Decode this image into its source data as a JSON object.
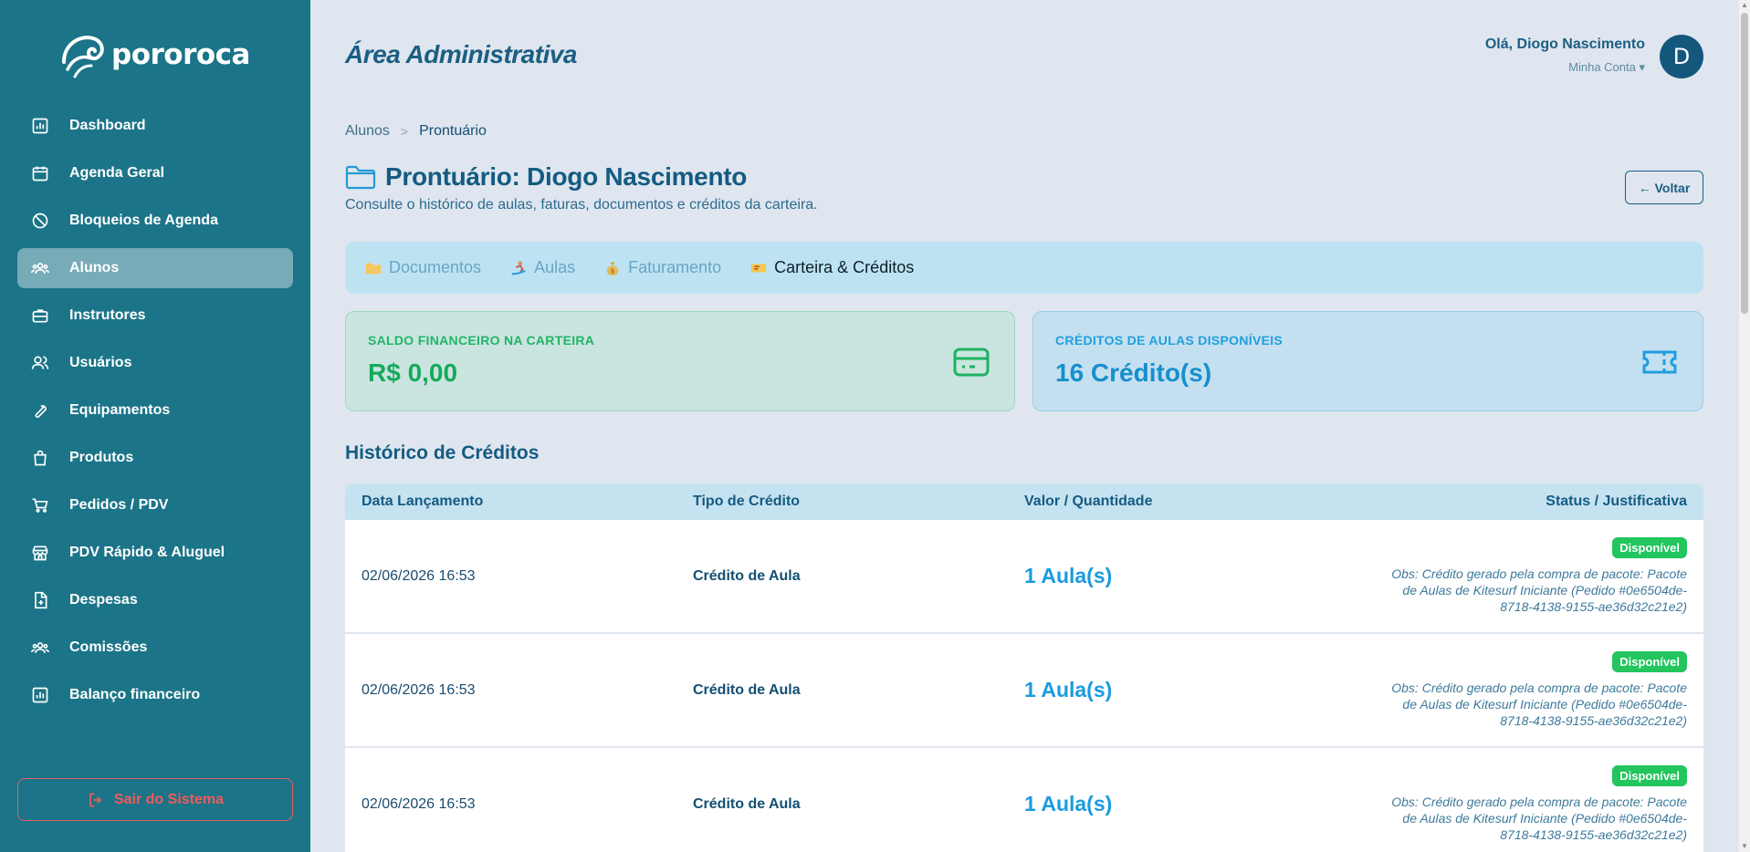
{
  "app": {
    "brand": "pororoca"
  },
  "sidebar": {
    "items": [
      {
        "label": "Dashboard",
        "icon": "chart-bars-icon"
      },
      {
        "label": "Agenda Geral",
        "icon": "calendar-icon"
      },
      {
        "label": "Bloqueios de Agenda",
        "icon": "ban-icon"
      },
      {
        "label": "Alunos",
        "icon": "users-group-icon",
        "active": true
      },
      {
        "label": "Instrutores",
        "icon": "briefcase-icon"
      },
      {
        "label": "Usuários",
        "icon": "users-icon"
      },
      {
        "label": "Equipamentos",
        "icon": "wrench-icon"
      },
      {
        "label": "Produtos",
        "icon": "shopping-bag-icon"
      },
      {
        "label": "Pedidos / PDV",
        "icon": "cart-icon"
      },
      {
        "label": "PDV Rápido & Aluguel",
        "icon": "store-icon"
      },
      {
        "label": "Despesas",
        "icon": "file-plus-icon"
      },
      {
        "label": "Comissões",
        "icon": "users-group-icon"
      },
      {
        "label": "Balanço financeiro",
        "icon": "chart-bars-icon"
      }
    ],
    "logout_label": "Sair do Sistema"
  },
  "header": {
    "title": "Área Administrativa",
    "greeting": "Olá, Diogo Nascimento",
    "account_label": "Minha Conta ▾",
    "avatar_initial": "D"
  },
  "breadcrumb": {
    "parent": "Alunos",
    "separator": ">",
    "current": "Prontuário"
  },
  "page": {
    "title": "Prontuário: Diogo Nascimento",
    "subtitle": "Consulte o histórico de aulas, faturas, documentos e créditos da carteira.",
    "back_label": "← Voltar"
  },
  "tabs": [
    {
      "label": "Documentos",
      "emoji": "📁",
      "active": false
    },
    {
      "label": "Aulas",
      "emoji": "🏄",
      "active": false
    },
    {
      "label": "Faturamento",
      "emoji": "💰",
      "active": false
    },
    {
      "label": "Carteira & Créditos",
      "emoji": "🎫",
      "active": true
    }
  ],
  "cards": {
    "balance": {
      "label": "SALDO FINANCEIRO NA CARTEIRA",
      "value": "R$ 0,00",
      "color": "#17a95b"
    },
    "credits": {
      "label": "CRÉDITOS DE AULAS DISPONÍVEIS",
      "value": "16 Crédito(s)",
      "color": "#168fce"
    }
  },
  "history": {
    "title": "Histórico de Créditos",
    "columns": [
      "Data Lançamento",
      "Tipo de Crédito",
      "Valor / Quantidade",
      "Status / Justificativa"
    ],
    "rows": [
      {
        "date": "02/06/2026 16:53",
        "type": "Crédito de Aula",
        "amount": "1 Aula(s)",
        "status": "Disponível",
        "obs": "Obs: Crédito gerado pela compra de pacote: Pacote de Aulas de Kitesurf Iniciante (Pedido #0e6504de-8718-4138-9155-ae36d32c21e2)"
      },
      {
        "date": "02/06/2026 16:53",
        "type": "Crédito de Aula",
        "amount": "1 Aula(s)",
        "status": "Disponível",
        "obs": "Obs: Crédito gerado pela compra de pacote: Pacote de Aulas de Kitesurf Iniciante (Pedido #0e6504de-8718-4138-9155-ae36d32c21e2)"
      },
      {
        "date": "02/06/2026 16:53",
        "type": "Crédito de Aula",
        "amount": "1 Aula(s)",
        "status": "Disponível",
        "obs": "Obs: Crédito gerado pela compra de pacote: Pacote de Aulas de Kitesurf Iniciante (Pedido #0e6504de-8718-4138-9155-ae36d32c21e2)"
      }
    ]
  }
}
